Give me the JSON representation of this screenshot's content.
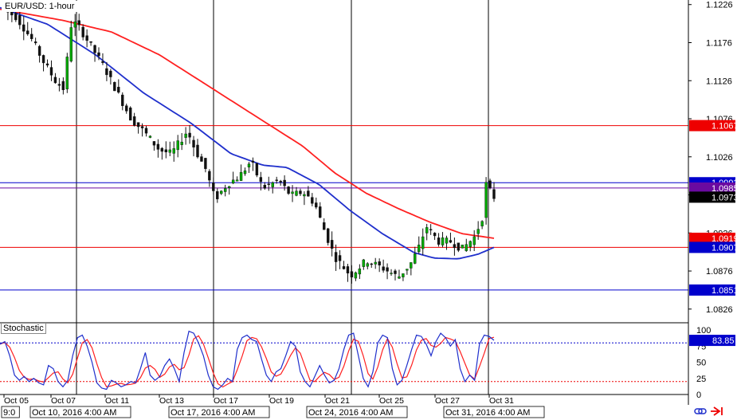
{
  "chart_title": "EUR/USD: 1-hour",
  "indicator_title": "Stochastic",
  "colors": {
    "bull": "#00aa00",
    "bear": "#111111",
    "sma_fast": "#1f2fcc",
    "sma_slow": "#ff2020",
    "hline_red": "#ee0000",
    "hline_blue": "#0000cc",
    "hline_purple": "#6a0aa0",
    "stoch_k": "#1f2fcc",
    "stoch_d": "#ff2020"
  },
  "chart_data": [
    {
      "type": "candlestick",
      "title": "EUR/USD: 1-hour",
      "y_axis_ticks": [
        "1.1226",
        "1.1176",
        "1.1126",
        "1.1076",
        "1.1026",
        "1.0976",
        "1.0926",
        "1.0876",
        "1.0826"
      ],
      "ylim": [
        1.0808,
        1.1232
      ],
      "x_axis_ticks": [
        "Oct 05",
        "Oct 07",
        "Oct 11",
        "Oct 13",
        "Oct 17",
        "Oct 19",
        "Oct 21",
        "Oct 25",
        "Oct 27",
        "Oct 31"
      ],
      "period_labels": [
        "9:0",
        "Oct 10, 2016 4:00 AM",
        "Oct 17, 2016 4:00 AM",
        "Oct 24, 2016 4:00 AM",
        "Oct 31, 2016 4:00 AM"
      ],
      "period_separators": [
        "Oct 10, 2016 4:00 AM",
        "Oct 17, 2016 4:00 AM",
        "Oct 24, 2016 4:00 AM",
        "Oct 31, 2016 4:00 AM"
      ],
      "horizontal_lines": [
        {
          "value": 1.1067,
          "label": "1.1067",
          "color": "red"
        },
        {
          "value": 1.0992,
          "label": "1.0992",
          "color": "blue"
        },
        {
          "value": 1.0985,
          "label": "1.0985",
          "color": "purple"
        },
        {
          "value": 1.0907,
          "label": "1.0907",
          "color": "red"
        },
        {
          "value": 1.0851,
          "label": "1.0851",
          "color": "blue"
        }
      ],
      "price_labels": [
        {
          "value": 1.1067,
          "label": "1.1067",
          "bg": "#ee0000",
          "fg": "#ffffff"
        },
        {
          "value": 1.0992,
          "label": "1.0992",
          "bg": "#0000cc",
          "fg": "#ffffff"
        },
        {
          "value": 1.0985,
          "label": "1.0985",
          "bg": "#6a0aa0",
          "fg": "#ffffff"
        },
        {
          "value": 1.0973,
          "label": "1.0973",
          "bg": "#000000",
          "fg": "#ffffff"
        },
        {
          "value": 1.0919,
          "label": "1.0919",
          "bg": "#ee0000",
          "fg": "#ffffff"
        },
        {
          "value": 1.0907,
          "label": "1.0907",
          "bg": "#0000cc",
          "fg": "#ffffff"
        },
        {
          "value": 1.0851,
          "label": "1.0851",
          "bg": "#0000cc",
          "fg": "#ffffff"
        }
      ],
      "close_path_keypoints": [
        [
          0,
          1.1222
        ],
        [
          20,
          1.121
        ],
        [
          40,
          1.118
        ],
        [
          55,
          1.115
        ],
        [
          70,
          1.1125
        ],
        [
          80,
          1.1115
        ],
        [
          90,
          1.1205
        ],
        [
          100,
          1.1195
        ],
        [
          115,
          1.117
        ],
        [
          130,
          1.1145
        ],
        [
          150,
          1.1105
        ],
        [
          165,
          1.1075
        ],
        [
          180,
          1.106
        ],
        [
          200,
          1.1035
        ],
        [
          215,
          1.103
        ],
        [
          225,
          1.1045
        ],
        [
          235,
          1.106
        ],
        [
          245,
          1.1035
        ],
        [
          258,
          1.101
        ],
        [
          270,
          1.097
        ],
        [
          285,
          1.099
        ],
        [
          300,
          1.1
        ],
        [
          315,
          1.102
        ],
        [
          330,
          1.0985
        ],
        [
          350,
          1.0995
        ],
        [
          365,
          1.0975
        ],
        [
          380,
          1.098
        ],
        [
          395,
          1.0965
        ],
        [
          405,
          1.0935
        ],
        [
          420,
          1.0895
        ],
        [
          440,
          1.087
        ],
        [
          460,
          1.089
        ],
        [
          480,
          1.088
        ],
        [
          500,
          1.0868
        ],
        [
          515,
          1.0885
        ],
        [
          525,
          1.0905
        ],
        [
          535,
          1.0935
        ],
        [
          550,
          1.0915
        ],
        [
          565,
          1.0915
        ],
        [
          580,
          1.0905
        ],
        [
          595,
          1.092
        ],
        [
          605,
          1.0945
        ],
        [
          610,
          1.099
        ],
        [
          620,
          1.0973
        ]
      ],
      "sma_fast_keypoints": [
        [
          0,
          1.1222
        ],
        [
          60,
          1.12
        ],
        [
          120,
          1.116
        ],
        [
          180,
          1.111
        ],
        [
          240,
          1.107
        ],
        [
          290,
          1.103
        ],
        [
          330,
          1.1015
        ],
        [
          360,
          1.1012
        ],
        [
          400,
          1.099
        ],
        [
          440,
          1.0955
        ],
        [
          480,
          1.0925
        ],
        [
          520,
          1.09
        ],
        [
          545,
          1.0893
        ],
        [
          575,
          1.0892
        ],
        [
          600,
          1.0898
        ],
        [
          620,
          1.0907
        ]
      ],
      "sma_slow_keypoints": [
        [
          0,
          1.122
        ],
        [
          80,
          1.1205
        ],
        [
          140,
          1.119
        ],
        [
          200,
          1.116
        ],
        [
          260,
          1.112
        ],
        [
          320,
          1.108
        ],
        [
          380,
          1.104
        ],
        [
          420,
          1.1005
        ],
        [
          460,
          1.0978
        ],
        [
          500,
          1.0958
        ],
        [
          540,
          1.094
        ],
        [
          580,
          1.0925
        ],
        [
          620,
          1.0919
        ]
      ],
      "candle_count": 125
    },
    {
      "type": "line",
      "title": "Stochastic",
      "y_axis_ticks": [
        "100",
        "75",
        "50",
        "25",
        "0"
      ],
      "ylim": [
        0,
        100
      ],
      "reference_lines": [
        80,
        20
      ],
      "current_value_label": "83.85",
      "series": [
        {
          "name": "",
          "values": [
            78,
            82,
            60,
            30,
            22,
            28,
            20,
            25,
            18,
            15,
            45,
            40,
            20,
            12,
            22,
            60,
            88,
            92,
            75,
            50,
            18,
            10,
            8,
            22,
            18,
            12,
            15,
            20,
            18,
            40,
            65,
            30,
            22,
            28,
            45,
            55,
            40,
            20,
            65,
            98,
            95,
            80,
            60,
            30,
            12,
            8,
            15,
            25,
            20,
            70,
            88,
            92,
            85,
            82,
            55,
            30,
            20,
            35,
            40,
            60,
            82,
            75,
            35,
            20,
            12,
            28,
            45,
            30,
            18,
            22,
            40,
            70,
            92,
            95,
            60,
            25,
            12,
            35,
            80,
            92,
            88,
            40,
            15,
            22,
            45,
            70,
            92,
            90,
            78,
            60,
            82,
            95,
            88,
            75,
            85,
            40,
            20,
            30,
            22,
            78,
            92,
            90,
            84
          ]
        }
      ]
    }
  ]
}
